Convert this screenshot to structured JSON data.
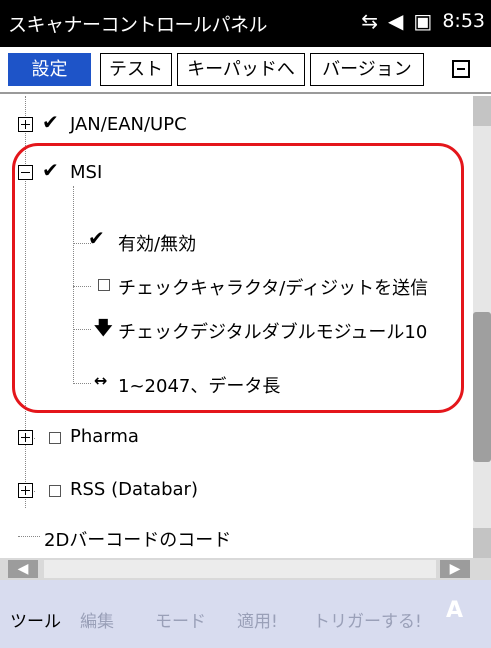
{
  "titlebar": {
    "title": "スキャナーコントロールパネル",
    "clock": "8:53",
    "icons": [
      "network-icon",
      "volume-icon",
      "battery-icon"
    ]
  },
  "tabs": [
    {
      "label": "設定",
      "active": true
    },
    {
      "label": "テスト",
      "active": false
    },
    {
      "label": "キーパッドへ",
      "active": false
    },
    {
      "label": "バージョン",
      "active": false
    }
  ],
  "tree": {
    "jan": {
      "label": "JAN/EAN/UPC",
      "checked": true,
      "expanded": false
    },
    "msi": {
      "label": "MSI",
      "checked": true,
      "expanded": true,
      "children": [
        {
          "label": "有効/無効",
          "icon": "check"
        },
        {
          "label": "チェックキャラクタ/ディジットを送信",
          "icon": "box"
        },
        {
          "label": "チェックデジタルダブルモジュール10",
          "icon": "down-arrow"
        },
        {
          "label": "1~2047、データ長",
          "icon": "range"
        }
      ]
    },
    "pharma": {
      "label": "Pharma",
      "checked": false,
      "expanded": false
    },
    "rss": {
      "label": "RSS (Databar)",
      "checked": false,
      "expanded": false
    },
    "twod": {
      "label": "2Dバーコードのコード"
    }
  },
  "menubar": {
    "tools": "ツール",
    "edit": "編集",
    "mode": "モード",
    "apply": "適用!",
    "trigger": "トリガーする!",
    "sip": "A"
  }
}
